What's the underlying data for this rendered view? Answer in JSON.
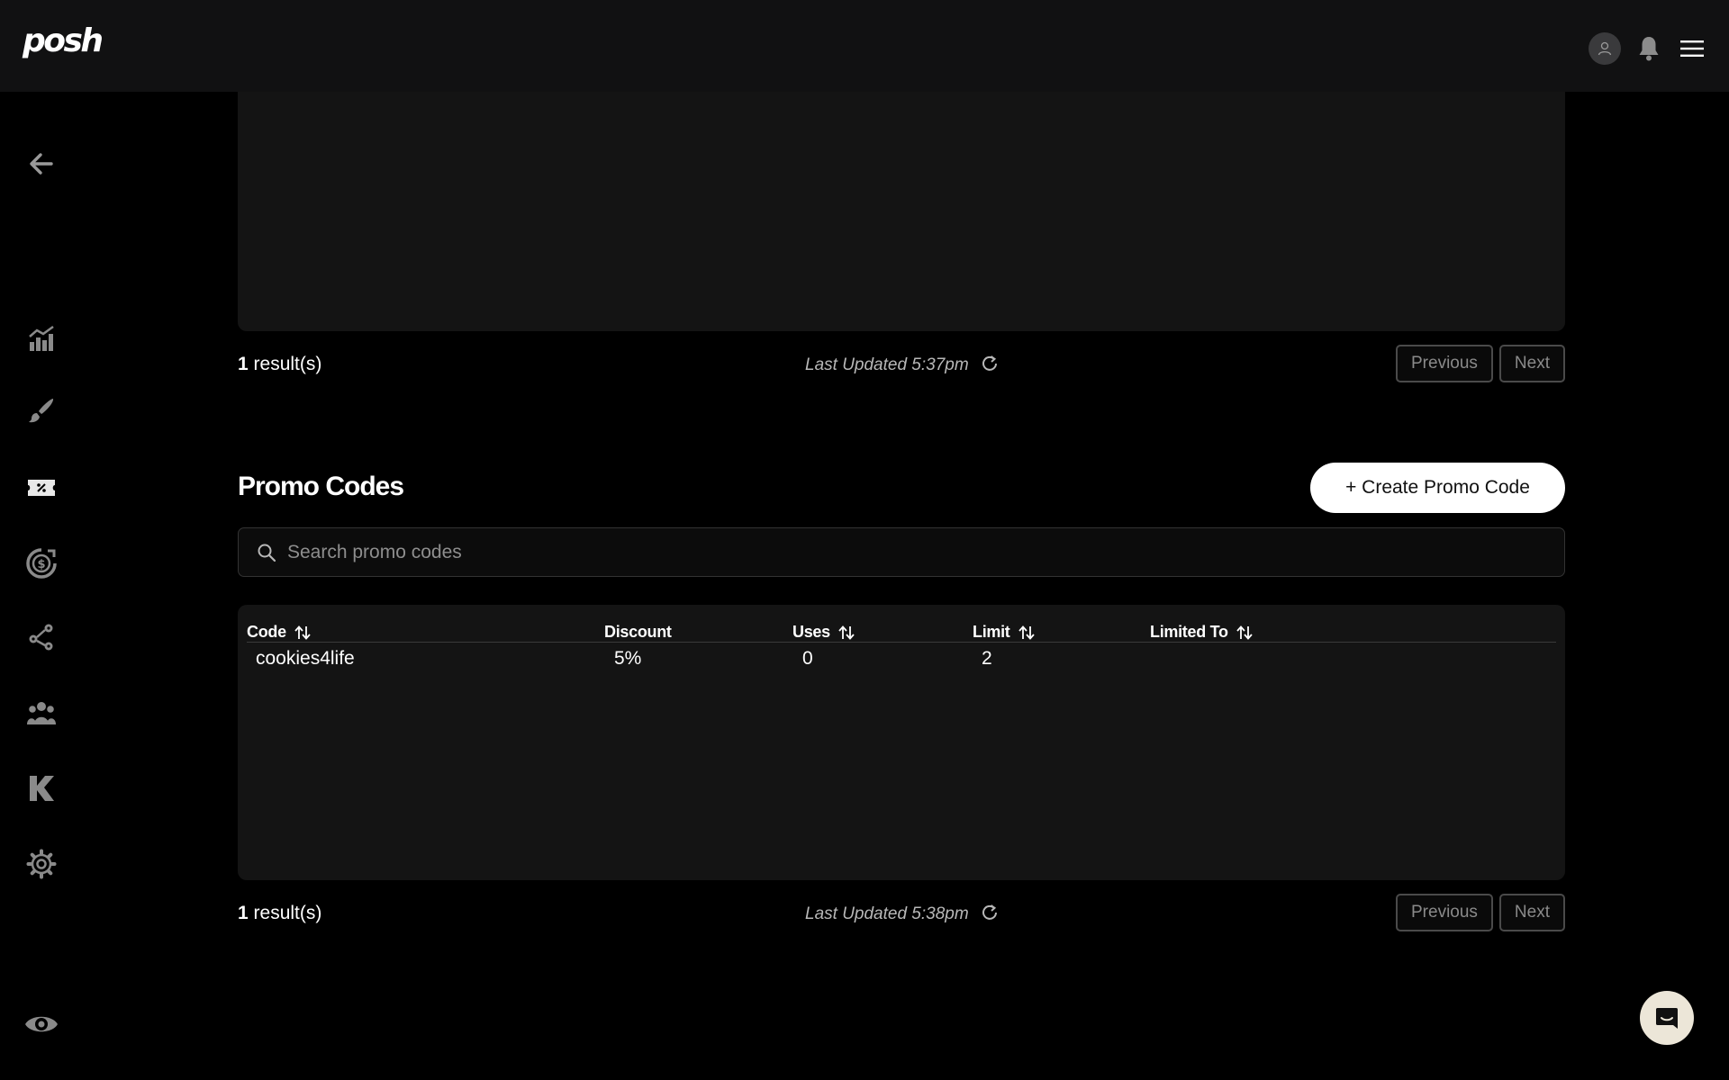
{
  "brand": {
    "logo_text": "posh"
  },
  "top_panel": {
    "results_count": "1",
    "results_suffix": " result(s)",
    "last_updated": "Last Updated 5:37pm",
    "prev_label": "Previous",
    "next_label": "Next"
  },
  "promo": {
    "title": "Promo Codes",
    "create_label": "+ Create Promo Code",
    "search_placeholder": "Search promo codes",
    "columns": {
      "code": "Code",
      "discount": "Discount",
      "uses": "Uses",
      "limit": "Limit",
      "limited_to": "Limited To"
    },
    "rows": [
      {
        "code": "cookies4life",
        "discount": "5%",
        "uses": "0",
        "limit": "2",
        "limited_to": ""
      }
    ],
    "results_count": "1",
    "results_suffix": " result(s)",
    "last_updated": "Last Updated 5:38pm",
    "prev_label": "Previous",
    "next_label": "Next"
  },
  "sidebar": {
    "items": [
      {
        "icon": "back-arrow-icon"
      },
      {
        "icon": "analytics-chart-icon"
      },
      {
        "icon": "paint-brush-icon"
      },
      {
        "icon": "ticket-icon"
      },
      {
        "icon": "money-icon"
      },
      {
        "icon": "network-icon"
      },
      {
        "icon": "team-icon"
      },
      {
        "icon": "kickback-icon"
      },
      {
        "icon": "gear-icon"
      },
      {
        "icon": "eye-icon"
      }
    ]
  },
  "colors": {
    "background": "#000000",
    "panel": "#141414",
    "topbar": "#111112",
    "accent_button": "#ffffff",
    "muted_text": "#b8b8b8"
  }
}
